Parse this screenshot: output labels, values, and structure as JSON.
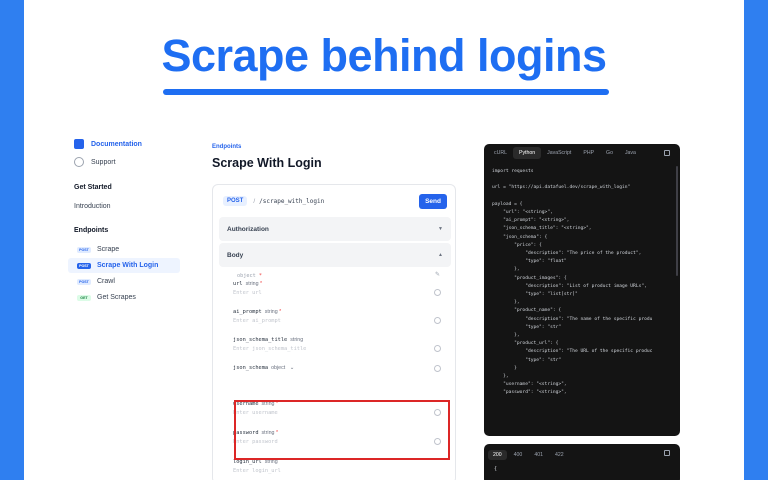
{
  "hero": {
    "title": "Scrape behind logins"
  },
  "sidebar": {
    "top": [
      {
        "label": "Documentation",
        "icon": "doc-icon"
      },
      {
        "label": "Support",
        "icon": "support-icon"
      }
    ],
    "get_started_heading": "Get Started",
    "introduction": "Introduction",
    "endpoints_heading": "Endpoints",
    "endpoints": [
      {
        "method": "POST",
        "label": "Scrape"
      },
      {
        "method": "POST",
        "label": "Scrape With Login"
      },
      {
        "method": "POST",
        "label": "Crawl"
      },
      {
        "method": "GET",
        "label": "Get Scrapes"
      }
    ]
  },
  "main": {
    "breadcrumb": "Endpoints",
    "title": "Scrape With Login",
    "method": "POST",
    "path": "/scrape_with_login",
    "send_label": "Send",
    "authorization_label": "Authorization",
    "body_label": "Body",
    "object_label": "object",
    "fields": [
      {
        "name": "url",
        "type": "string",
        "req": "*",
        "placeholder": "Enter url"
      },
      {
        "name": "ai_prompt",
        "type": "string",
        "req": "*",
        "placeholder": "Enter ai_prompt"
      },
      {
        "name": "json_schema_title",
        "type": "string",
        "req": "",
        "placeholder": "Enter json_schema_title"
      },
      {
        "name": "json_schema",
        "type": "object",
        "req": "",
        "placeholder": ""
      },
      {
        "name": "username",
        "type": "string",
        "req": "*",
        "placeholder": "Enter username"
      },
      {
        "name": "password",
        "type": "string",
        "req": "*",
        "placeholder": "Enter password"
      },
      {
        "name": "login_url",
        "type": "string",
        "req": "",
        "placeholder": "Enter login_url"
      }
    ]
  },
  "code": {
    "tabs": [
      "cURL",
      "Python",
      "JavaScript",
      "PHP",
      "Go",
      "Java"
    ],
    "active_tab": "Python",
    "text": "import requests\n\nurl = \"https://api.datafuel.dev/scrape_with_login\"\n\npayload = {\n    \"url\": \"<string>\",\n    \"ai_prompt\": \"<string>\",\n    \"json_schema_title\": \"<string>\",\n    \"json_schema\": {\n        \"price\": {\n            \"description\": \"The price of the product\",\n            \"type\": \"float\"\n        },\n        \"product_images\": {\n            \"description\": \"List of product image URLs\",\n            \"type\": \"list[str]\"\n        },\n        \"product_name\": {\n            \"description\": \"The name of the specific produ\n            \"type\": \"str\"\n        },\n        \"product_url\": {\n            \"description\": \"The URL of the specific produc\n            \"type\": \"str\"\n        }\n    },\n    \"username\": \"<string>\",\n    \"password\": \"<string>\","
  },
  "response": {
    "tabs": [
      "200",
      "400",
      "401",
      "422"
    ],
    "active_tab": "200",
    "body": "{"
  },
  "colors": {
    "brand": "#1e6ef2",
    "highlight": "#dc2626",
    "backdrop": "#2f7ff0"
  }
}
